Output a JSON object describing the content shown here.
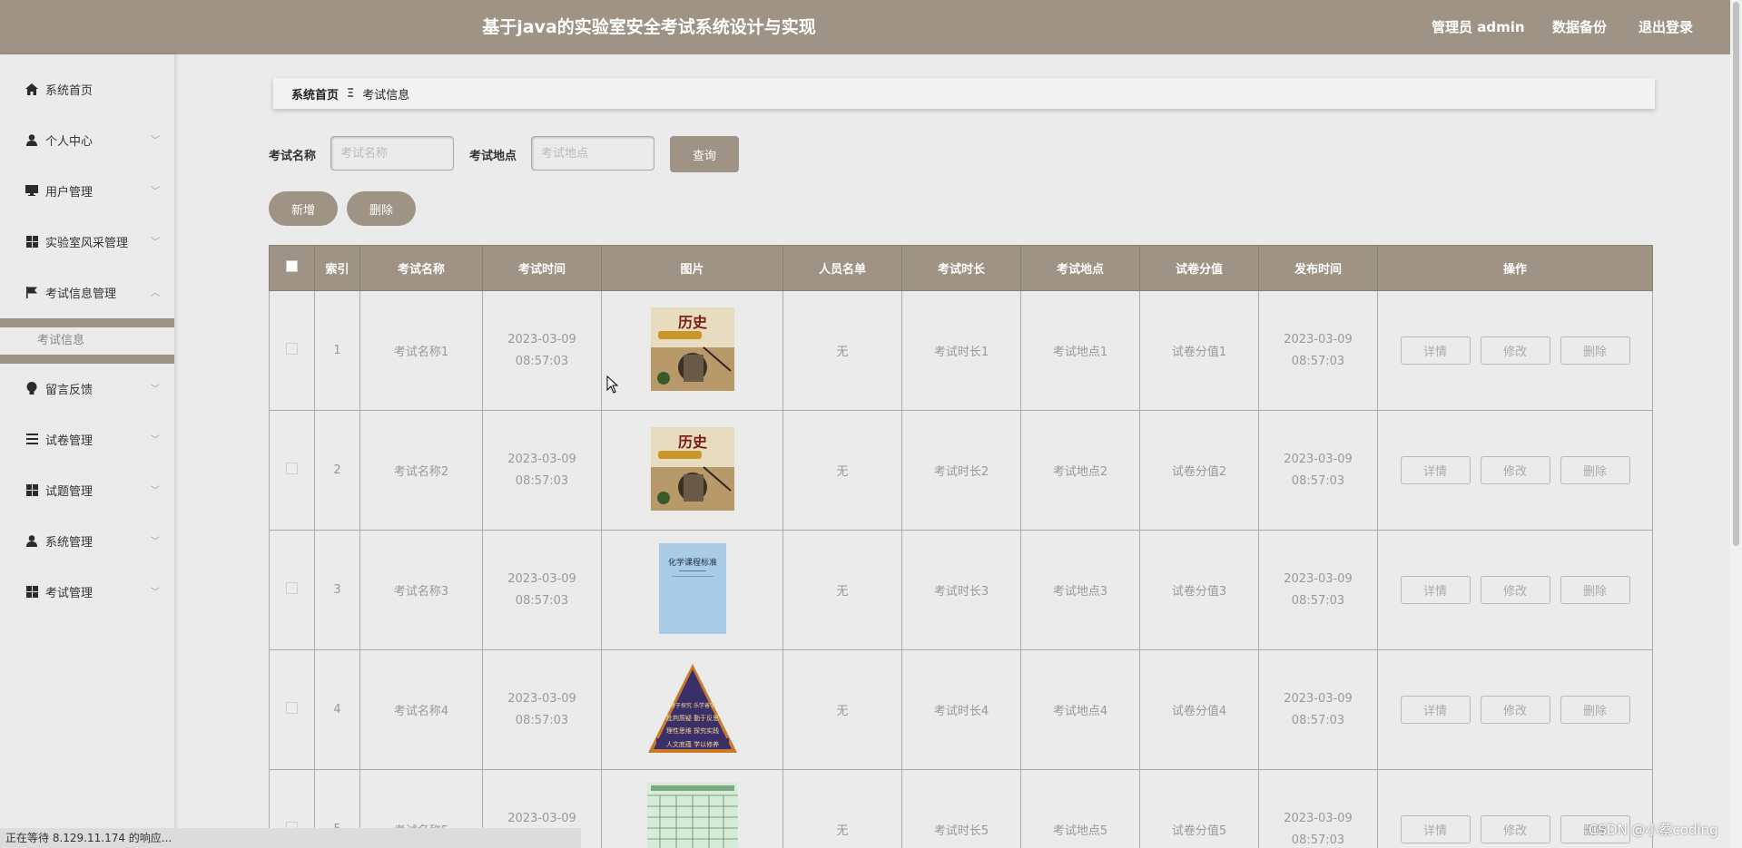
{
  "header": {
    "title": "基于java的实验室安全考试系统设计与实现",
    "admin": "管理员 admin",
    "backup": "数据备份",
    "logout": "退出登录"
  },
  "sidebar": {
    "items": [
      {
        "label": "系统首页",
        "icon": "home-icon"
      },
      {
        "label": "个人中心",
        "icon": "user-icon"
      },
      {
        "label": "用户管理",
        "icon": "monitor-icon"
      },
      {
        "label": "实验室风采管理",
        "icon": "grid-icon"
      },
      {
        "label": "考试信息管理",
        "icon": "flag-icon"
      },
      {
        "label": "留言反馈",
        "icon": "bulb-icon"
      },
      {
        "label": "试卷管理",
        "icon": "list-icon"
      },
      {
        "label": "试题管理",
        "icon": "grid-icon"
      },
      {
        "label": "系统管理",
        "icon": "user-icon"
      },
      {
        "label": "考试管理",
        "icon": "grid-icon"
      }
    ],
    "submenu": "考试信息"
  },
  "breadcrumb": {
    "home": "系统首页",
    "sep": "Ξ",
    "current": "考试信息"
  },
  "search": {
    "name_label": "考试名称",
    "name_placeholder": "考试名称",
    "place_label": "考试地点",
    "place_placeholder": "考试地点",
    "query": "查询",
    "add": "新增",
    "delete": "删除"
  },
  "table": {
    "headers": [
      "索引",
      "考试名称",
      "考试时间",
      "图片",
      "人员名单",
      "考试时长",
      "考试地点",
      "试卷分值",
      "发布时间",
      "操作"
    ],
    "rows": [
      {
        "index": "1",
        "name": "考试名称1",
        "time": "2023-03-09 08:57:03",
        "image": "history-book",
        "people": "无",
        "duration": "考试时长1",
        "place": "考试地点1",
        "score": "试卷分值1",
        "publish": "2023-03-09 08:57:03"
      },
      {
        "index": "2",
        "name": "考试名称2",
        "time": "2023-03-09 08:57:03",
        "image": "history-book",
        "people": "无",
        "duration": "考试时长2",
        "place": "考试地点2",
        "score": "试卷分值2",
        "publish": "2023-03-09 08:57:03"
      },
      {
        "index": "3",
        "name": "考试名称3",
        "time": "2023-03-09 08:57:03",
        "image": "chemistry-book",
        "people": "无",
        "duration": "考试时长3",
        "place": "考试地点3",
        "score": "试卷分值3",
        "publish": "2023-03-09 08:57:03"
      },
      {
        "index": "4",
        "name": "考试名称4",
        "time": "2023-03-09 08:57:03",
        "image": "pyramid",
        "people": "无",
        "duration": "考试时长4",
        "place": "考试地点4",
        "score": "试卷分值4",
        "publish": "2023-03-09 08:57:03"
      },
      {
        "index": "5",
        "name": "考试名称5",
        "time": "2023-03-09 08:57:03",
        "image": "green-table",
        "people": "无",
        "duration": "考试时长5",
        "place": "考试地点5",
        "score": "试卷分值5",
        "publish": "2023-03-09 08:57:03"
      }
    ],
    "ops": [
      "详情",
      "修改",
      "删除"
    ]
  },
  "thumbs": {
    "history_title": "历史",
    "chem_title": "化学课程标准",
    "pyramid_lines": [
      "人文底蕴 学以修养",
      "理性思维 探究实践",
      "批判质疑 勤于反思",
      "勇于探究 乐学善学"
    ]
  },
  "status": "正在等待 8.129.11.174 的响应...",
  "watermark": "CSDN @小蔡coding",
  "colors": {
    "accent": "#9e9384"
  }
}
